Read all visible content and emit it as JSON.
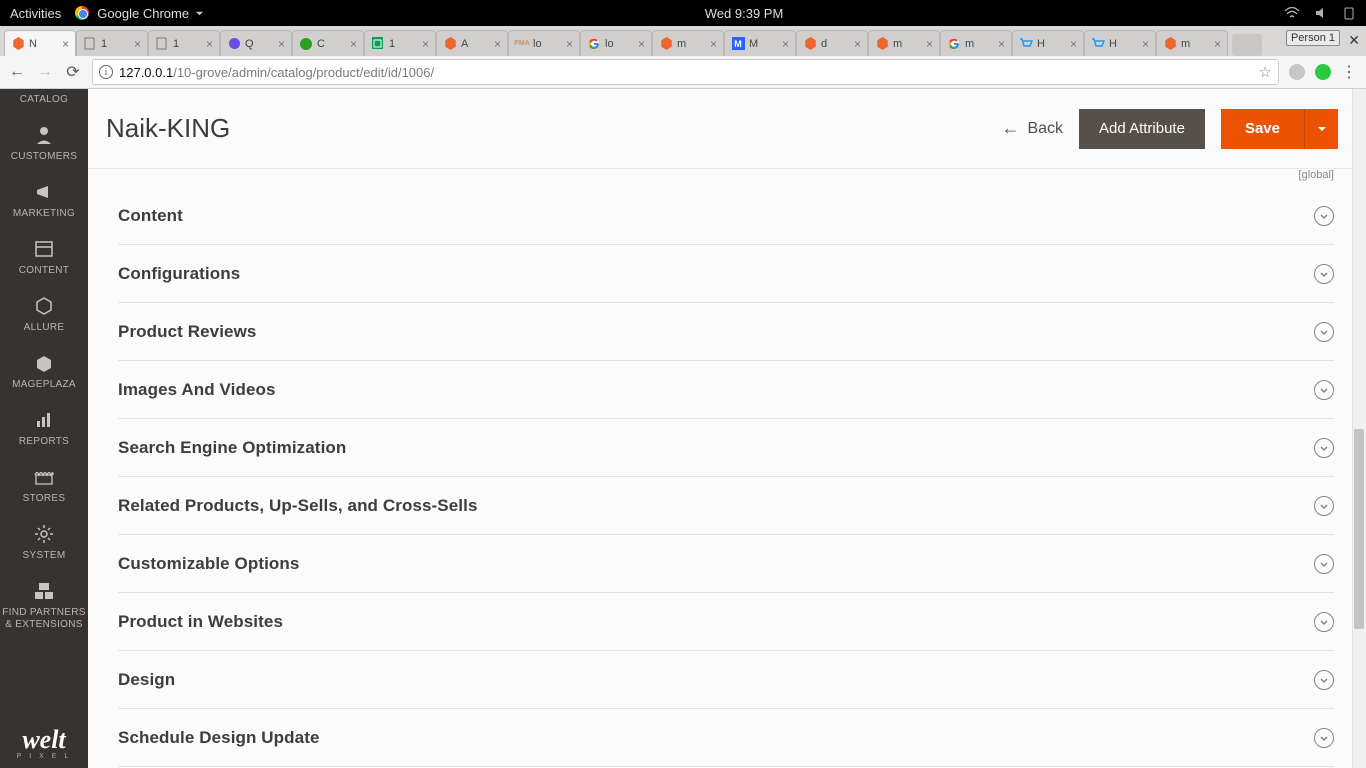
{
  "os": {
    "activities": "Activities",
    "app_name": "Google Chrome",
    "clock": "Wed  9:39 PM"
  },
  "browser": {
    "tabs": [
      {
        "label": "N",
        "favicon": "magento"
      },
      {
        "label": "1",
        "favicon": "page"
      },
      {
        "label": "1",
        "favicon": "page"
      },
      {
        "label": "Q",
        "favicon": "purple"
      },
      {
        "label": "C",
        "favicon": "qb"
      },
      {
        "label": "1",
        "favicon": "sheets"
      },
      {
        "label": "A",
        "favicon": "magento"
      },
      {
        "label": "lo",
        "favicon": "pma"
      },
      {
        "label": "lo",
        "favicon": "google"
      },
      {
        "label": "m",
        "favicon": "magento"
      },
      {
        "label": "M",
        "favicon": "msquare"
      },
      {
        "label": "d",
        "favicon": "magento"
      },
      {
        "label": "m",
        "favicon": "magento"
      },
      {
        "label": "m",
        "favicon": "google"
      },
      {
        "label": "H",
        "favicon": "cart"
      },
      {
        "label": "H",
        "favicon": "cart"
      },
      {
        "label": "m",
        "favicon": "magento"
      }
    ],
    "persona": "Person 1",
    "url_host": "127.0.0.1",
    "url_path": "/10-grove/admin/catalog/product/edit/id/1006/"
  },
  "sidebar": {
    "items": [
      {
        "label": "CATALOG",
        "icon": "tag"
      },
      {
        "label": "CUSTOMERS",
        "icon": "person"
      },
      {
        "label": "MARKETING",
        "icon": "megaphone"
      },
      {
        "label": "CONTENT",
        "icon": "layout"
      },
      {
        "label": "ALLURE",
        "icon": "hex"
      },
      {
        "label": "MAGEPLAZA",
        "icon": "box"
      },
      {
        "label": "REPORTS",
        "icon": "bars"
      },
      {
        "label": "STORES",
        "icon": "store"
      },
      {
        "label": "SYSTEM",
        "icon": "gear"
      },
      {
        "label": "FIND PARTNERS\n& EXTENSIONS",
        "icon": "boxes"
      }
    ],
    "logo_text": "welt",
    "logo_sub": "P I X E L"
  },
  "page": {
    "title": "Naik-KING",
    "global_hint": "[global]",
    "back": "Back",
    "add_attribute": "Add Attribute",
    "save": "Save",
    "sections": [
      "Content",
      "Configurations",
      "Product Reviews",
      "Images And Videos",
      "Search Engine Optimization",
      "Related Products, Up-Sells, and Cross-Sells",
      "Customizable Options",
      "Product in Websites",
      "Design",
      "Schedule Design Update"
    ]
  }
}
